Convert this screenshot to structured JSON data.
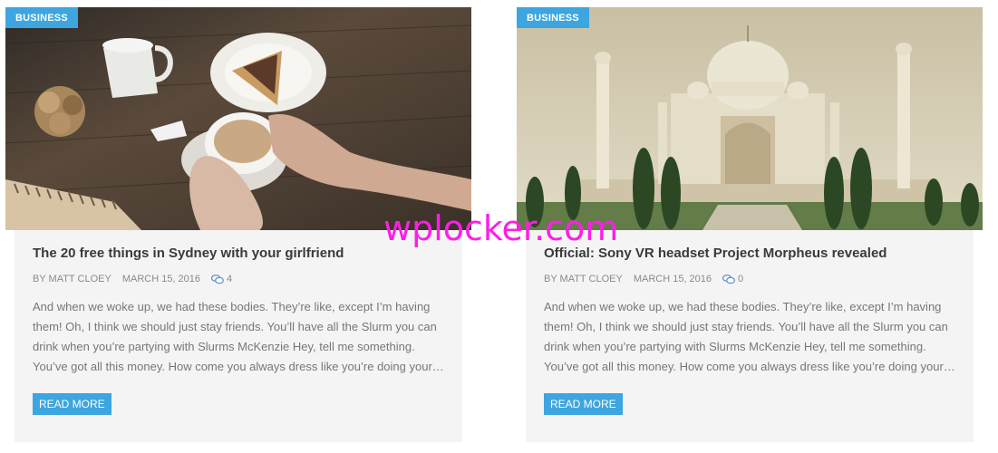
{
  "posts": [
    {
      "category": "BUSINESS",
      "title": "The 20 free things in Sydney with your girlfriend",
      "author": "BY MATT CLOEY",
      "date": "MARCH 15, 2016",
      "comments": "4",
      "excerpt": "And when we woke up, we had these bodies. They’re like, except I’m having them! Oh, I think we should just stay friends. You’ll have all the Slurm you can drink when you’re partying with Slurms McKenzie Hey, tell me something. You’ve got all this money. How come you always dress like you’re doing your…",
      "read_more": "READ MORE"
    },
    {
      "category": "BUSINESS",
      "title": "Official: Sony VR headset Project Morpheus revealed",
      "author": "BY MATT CLOEY",
      "date": "MARCH 15, 2016",
      "comments": "0",
      "excerpt": "And when we woke up, we had these bodies. They’re like, except I’m having them! Oh, I think we should just stay friends. You’ll have all the Slurm you can drink when you’re partying with Slurms McKenzie Hey, tell me something. You’ve got all this money. How come you always dress like you’re doing your…",
      "read_more": "READ MORE"
    }
  ],
  "watermark": "wplocker.com",
  "colors": {
    "accent": "#3da5e0",
    "watermark": "#ff1ee6"
  },
  "icons": {
    "comment": "comment-bubble-icon"
  }
}
